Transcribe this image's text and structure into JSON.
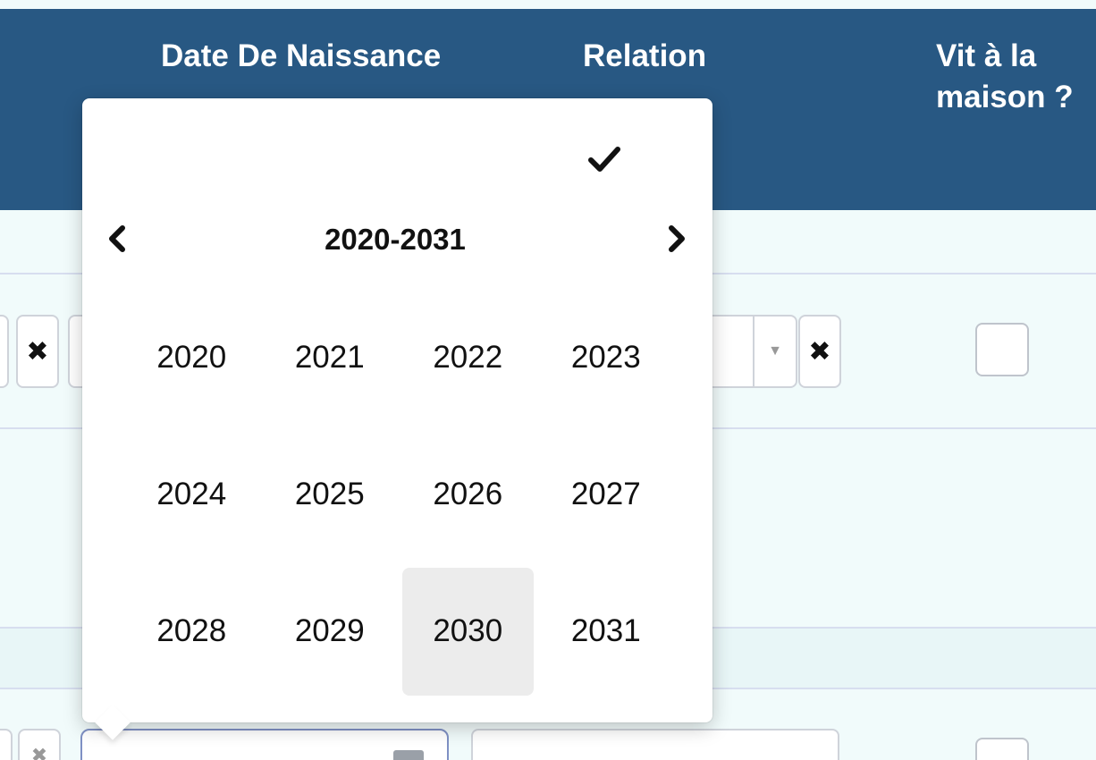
{
  "table": {
    "headers": {
      "birth_date": "Date De Naissance",
      "relation": "Relation",
      "lives_home_line1": "Vit à la",
      "lives_home_line2": "maison ?"
    }
  },
  "rows": [
    {
      "clear_label": "✖",
      "relation_clear_label": "✖",
      "select_arrow": "▼",
      "lives_home_checked": false
    },
    {
      "clear_label": "✖",
      "lives_home_checked": false
    }
  ],
  "year_picker": {
    "range_label": "2020-2031",
    "years": [
      "2020",
      "2021",
      "2022",
      "2023",
      "2024",
      "2025",
      "2026",
      "2027",
      "2028",
      "2029",
      "2030",
      "2031"
    ],
    "highlighted_year": "2030",
    "icons": {
      "confirm": "checkmark-icon",
      "prev": "chevron-left-icon",
      "next": "chevron-right-icon"
    }
  },
  "colors": {
    "header_bg": "#285883",
    "header_text": "#ffffff",
    "body_bg": "#f1fbfb",
    "highlight_bg": "#ececec"
  }
}
